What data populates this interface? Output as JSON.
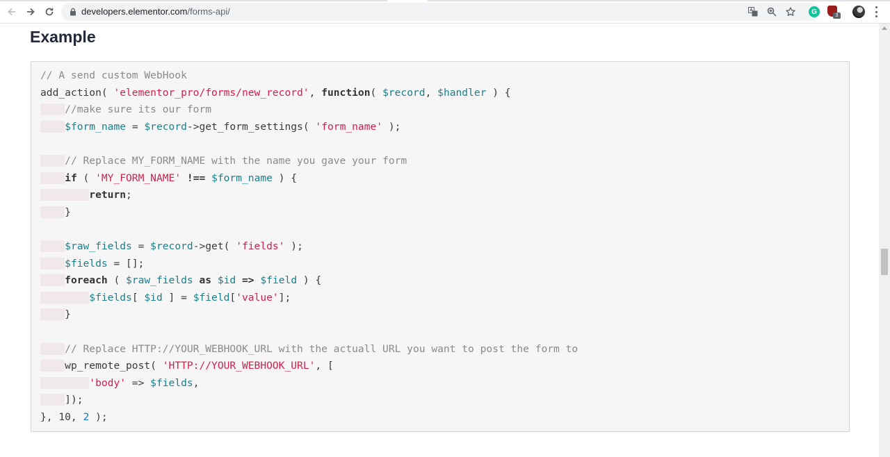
{
  "browser": {
    "url_host": "developers.elementor.com",
    "url_path": "/forms-api/",
    "accent_colors": {
      "grammarly": "#15c39a",
      "shield": "#9b1c1c"
    },
    "extension_badge": "3"
  },
  "page": {
    "heading": "Example"
  },
  "code": {
    "lines": [
      [
        {
          "t": "// A send custom WebHook",
          "c": "c-com"
        }
      ],
      [
        {
          "t": "add_action( "
        },
        {
          "t": "'elementor_pro/forms/new_record'",
          "c": "c-str"
        },
        {
          "t": ", "
        },
        {
          "t": "function",
          "c": "c-kw"
        },
        {
          "t": "( "
        },
        {
          "t": "$record",
          "c": "c-var"
        },
        {
          "t": ", "
        },
        {
          "t": "$handler",
          "c": "c-var"
        },
        {
          "t": " ) {"
        }
      ],
      [
        {
          "t": "    ",
          "c": "ind"
        },
        {
          "t": "//make sure its our form",
          "c": "c-com"
        }
      ],
      [
        {
          "t": "    ",
          "c": "ind"
        },
        {
          "t": "$form_name",
          "c": "c-var"
        },
        {
          "t": " = "
        },
        {
          "t": "$record",
          "c": "c-var"
        },
        {
          "t": "->get_form_settings( "
        },
        {
          "t": "'form_name'",
          "c": "c-str"
        },
        {
          "t": " );"
        }
      ],
      [],
      [
        {
          "t": "    ",
          "c": "ind"
        },
        {
          "t": "// Replace MY_FORM_NAME with the name you gave your form",
          "c": "c-com"
        }
      ],
      [
        {
          "t": "    ",
          "c": "ind"
        },
        {
          "t": "if",
          "c": "c-kw"
        },
        {
          "t": " ( "
        },
        {
          "t": "'MY_FORM_NAME'",
          "c": "c-str"
        },
        {
          "t": " "
        },
        {
          "t": "!==",
          "c": "c-kw"
        },
        {
          "t": " "
        },
        {
          "t": "$form_name",
          "c": "c-var"
        },
        {
          "t": " ) {"
        }
      ],
      [
        {
          "t": "        ",
          "c": "ind"
        },
        {
          "t": "return",
          "c": "c-kw"
        },
        {
          "t": ";"
        }
      ],
      [
        {
          "t": "    ",
          "c": "ind"
        },
        {
          "t": "}"
        }
      ],
      [],
      [
        {
          "t": "    ",
          "c": "ind"
        },
        {
          "t": "$raw_fields",
          "c": "c-var"
        },
        {
          "t": " = "
        },
        {
          "t": "$record",
          "c": "c-var"
        },
        {
          "t": "->get( "
        },
        {
          "t": "'fields'",
          "c": "c-str"
        },
        {
          "t": " );"
        }
      ],
      [
        {
          "t": "    ",
          "c": "ind"
        },
        {
          "t": "$fields",
          "c": "c-var"
        },
        {
          "t": " = [];"
        }
      ],
      [
        {
          "t": "    ",
          "c": "ind"
        },
        {
          "t": "foreach",
          "c": "c-kw"
        },
        {
          "t": " ( "
        },
        {
          "t": "$raw_fields",
          "c": "c-var"
        },
        {
          "t": " "
        },
        {
          "t": "as",
          "c": "c-kw"
        },
        {
          "t": " "
        },
        {
          "t": "$id",
          "c": "c-var"
        },
        {
          "t": " "
        },
        {
          "t": "=>",
          "c": "c-kw"
        },
        {
          "t": " "
        },
        {
          "t": "$field",
          "c": "c-var"
        },
        {
          "t": " ) {"
        }
      ],
      [
        {
          "t": "        ",
          "c": "ind"
        },
        {
          "t": "$fields",
          "c": "c-var"
        },
        {
          "t": "[ "
        },
        {
          "t": "$id",
          "c": "c-var"
        },
        {
          "t": " ] = "
        },
        {
          "t": "$field",
          "c": "c-var"
        },
        {
          "t": "["
        },
        {
          "t": "'value'",
          "c": "c-str"
        },
        {
          "t": "];"
        }
      ],
      [
        {
          "t": "    ",
          "c": "ind"
        },
        {
          "t": "}"
        }
      ],
      [],
      [
        {
          "t": "    ",
          "c": "ind"
        },
        {
          "t": "// Replace HTTP://YOUR_WEBHOOK_URL with the actuall URL you want to post the form to",
          "c": "c-com"
        }
      ],
      [
        {
          "t": "    ",
          "c": "ind"
        },
        {
          "t": "wp_remote_post( "
        },
        {
          "t": "'HTTP://YOUR_WEBHOOK_URL'",
          "c": "c-str"
        },
        {
          "t": ", ["
        }
      ],
      [
        {
          "t": "        ",
          "c": "ind"
        },
        {
          "t": "'body'",
          "c": "c-str"
        },
        {
          "t": " => "
        },
        {
          "t": "$fields",
          "c": "c-var"
        },
        {
          "t": ","
        }
      ],
      [
        {
          "t": "    ",
          "c": "ind"
        },
        {
          "t": "]);"
        }
      ],
      [
        {
          "t": "}, 10, "
        },
        {
          "t": "2",
          "c": "c-num"
        },
        {
          "t": " );"
        }
      ]
    ]
  },
  "icons": {
    "back": "arrow-left-icon",
    "forward": "arrow-right-icon",
    "reload": "reload-icon",
    "lock": "lock-icon",
    "translate": "translate-icon",
    "zoom": "zoom-icon",
    "bookmark": "star-icon",
    "menu": "kebab-menu-icon"
  }
}
